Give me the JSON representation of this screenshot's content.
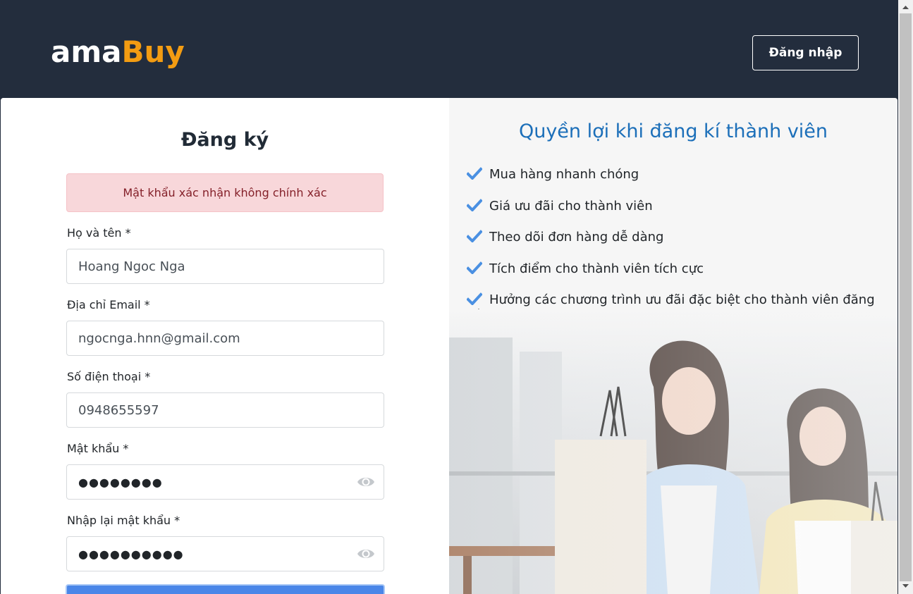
{
  "header": {
    "logo_part1": "ama",
    "logo_part2": "Buy",
    "login_label": "Đăng nhập"
  },
  "form": {
    "title": "Đăng ký",
    "error": "Mật khẩu xác nhận không chính xác",
    "fullname_label": "Họ và tên *",
    "fullname_value": "Hoang Ngoc Nga",
    "email_label": "Địa chỉ Email *",
    "email_value": "ngocnga.hnn@gmail.com",
    "phone_label": "Số điện thoại *",
    "phone_value": "0948655597",
    "password_label": "Mật khẩu *",
    "password_value": "●●●●●●●●",
    "confirm_label": "Nhập lại mật khẩu *",
    "confirm_value": "●●●●●●●●●●"
  },
  "benefits": {
    "title": "Quyền lợi khi đăng kí thành viên",
    "items": [
      "Mua hàng nhanh chóng",
      "Giá ưu đãi cho thành viên",
      "Theo dõi đơn hàng dễ dàng",
      "Tích điểm cho thành viên tích cực",
      "Hưởng các chương trình ưu đãi đặc biệt cho thành viên đăng ký"
    ]
  },
  "colors": {
    "header_bg": "#232d3d",
    "brand_accent": "#f39c12",
    "benefit_title": "#1c6fb9",
    "check": "#4a90e2",
    "alert_bg": "#f8d7da",
    "alert_text": "#842029",
    "primary_button": "#4a86e8"
  },
  "icons": {
    "check": "check-icon",
    "eye": "eye-icon"
  }
}
